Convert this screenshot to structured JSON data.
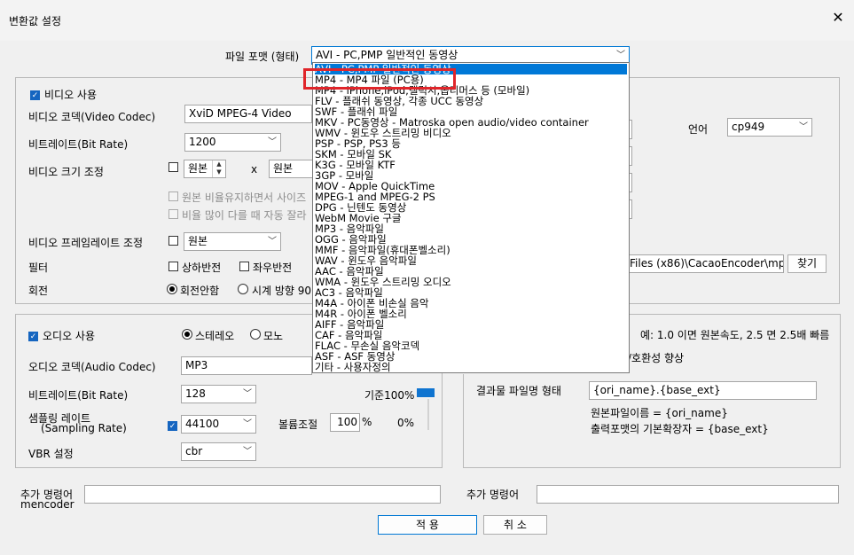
{
  "window": {
    "title": "변환값 설정"
  },
  "format": {
    "label": "파일 포맷 (형태)",
    "selected": "AVI - PC,PMP 일반적인 동영상",
    "options": [
      "AVI - PC,PMP 일반적인 동영상",
      "MP4 - MP4 파일 (PC용)",
      "MP4 - iPhone,iPod,갤럭시,옵티머스 등 (모바일)",
      "FLV - 플래쉬 동영상, 각종 UCC 동영상",
      "SWF - 플래쉬 파일",
      "MKV - PC동영상 - Matroska open audio/video container",
      "WMV - 윈도우 스트리밍 비디오",
      "PSP - PSP, PS3 등",
      "SKM - 모바일 SK",
      "K3G - 모바일 KTF",
      "3GP - 모바일",
      "MOV - Apple QuickTime",
      "MPEG-1 and MPEG-2 PS",
      "DPG - 닌텐도 동영상",
      "WebM Movie 구글",
      "MP3 - 음악파일",
      "OGG - 음악파일",
      "MMF - 음악파일(휴대폰벨소리)",
      "WAV - 윈도우 음악파일",
      "AAC - 음악파일",
      "WMA - 윈도우 스트리밍 오디오",
      "AC3 - 음악파일",
      "M4A - 아이폰 비손실 음악",
      "M4R - 아이폰 벨소리",
      "AIFF - 음악파일",
      "CAF - 음악파일",
      "FLAC - 무손실 음악코덱",
      "ASF - ASF 동영상",
      "기타 - 사용자정의"
    ]
  },
  "video": {
    "enable_label": "비디오 사용",
    "codec_label": "비디오 코덱(Video Codec)",
    "codec_value": "XviD MPEG-4 Video",
    "bitrate_label": "비트레이트(Bit Rate)",
    "bitrate_value": "1200",
    "size_label": "비디오 크기 조정",
    "width_value": "원본",
    "x_sep": "x",
    "height_value": "원본",
    "keep_ratio_label": "원본 비율유지하면서 사이즈",
    "auto_crop_label": "비율 많이 다를 때 자동 잘라",
    "framerate_label": "비디오 프레임레이트 조정",
    "framerate_value": "원본",
    "filter_label": "필터",
    "flip_v_label": "상하반전",
    "flip_h_label": "좌우반전",
    "rotate_label": "회전",
    "rotate_none_label": "회전안함",
    "rotate_cw_label": "시계 방향 90"
  },
  "subtitle": {
    "lang_label": "언어",
    "lang_value": "cp949",
    "path_value": "Files (x86)\\CacaoEncoder\\mp",
    "browse_label": "찾기"
  },
  "audio": {
    "enable_label": "오디오 사용",
    "stereo_label": "스테레오",
    "mono_label": "모노",
    "codec_label": "오디오 코덱(Audio Codec)",
    "codec_value": "MP3",
    "bitrate_label": "비트레이트(Bit Rate)",
    "bitrate_value": "128",
    "base_label": "기준100%",
    "sampling_label": "샘플링 레이트",
    "sampling_label2": "(Sampling Rate)",
    "sampling_value": "44100",
    "volume_label": "볼륨조절",
    "volume_value": "100",
    "volume_unit": "%",
    "volume_pct": "0%",
    "vbr_label": "VBR 설정",
    "vbr_value": "cbr"
  },
  "output": {
    "speed_note": "예: 1.0 이면 원본속도, 2.5 면 2.5배 빠름",
    "compat_note": "/호환성 향상",
    "filename_label": "결과물 파일명 형태",
    "filename_value": "{ori_name}.{base_ext}",
    "help_line1": "원본파일이름 = {ori_name}",
    "help_line2": "출력포맷의 기본확장자 = {base_ext}"
  },
  "extra": {
    "cmd_label": "추가 명령어",
    "cmd_sub": "mencoder",
    "cmd2_label": "추가 명령어"
  },
  "buttons": {
    "apply": "적 용",
    "cancel": "취 소"
  }
}
